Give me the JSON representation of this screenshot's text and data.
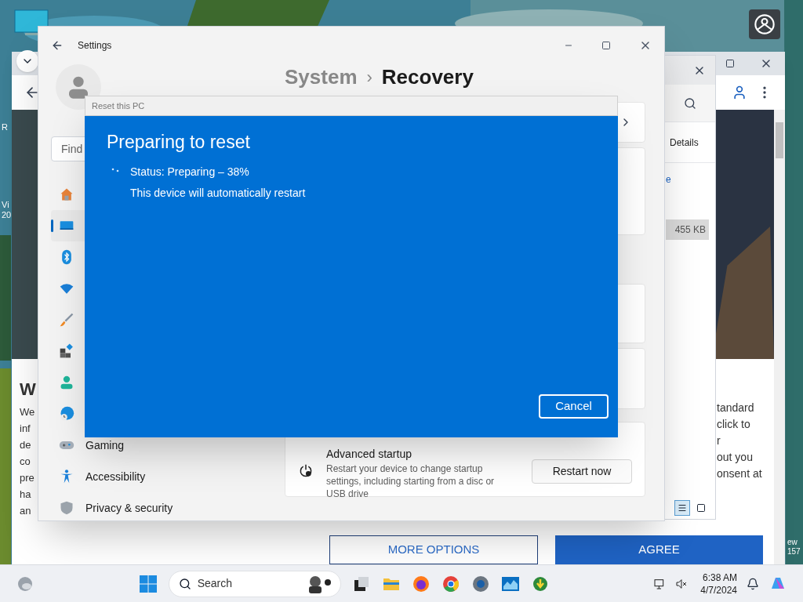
{
  "desktop": {
    "left_labels": [
      "R",
      "Vi",
      "20"
    ],
    "right_labels": [
      "ew",
      "157"
    ]
  },
  "browser": {
    "heading": "W",
    "left_text": [
      "We",
      "inf",
      "de",
      "co",
      "pre",
      "ha",
      "an"
    ],
    "right_text": [
      "tandard",
      "click to",
      "r",
      "out you",
      "onsent at"
    ],
    "buttons": [
      {
        "label": "MORE OPTIONS",
        "kind": "outline"
      },
      {
        "label": "AGREE",
        "kind": "filled"
      }
    ]
  },
  "explorer": {
    "tab": "Details",
    "link": "e",
    "size": "455 KB",
    "views": [
      {
        "selected": true
      },
      {
        "selected": false
      }
    ]
  },
  "settings": {
    "title": "Settings",
    "breadcrumb": [
      "System",
      "›",
      "Recovery"
    ],
    "search": {
      "placeholder": "Find"
    },
    "sidebar": [
      {
        "selected": false
      },
      {
        "selected": true
      },
      {
        "selected": false
      },
      {
        "selected": false
      },
      {
        "selected": false
      },
      {
        "selected": false
      },
      {
        "selected": false
      },
      {
        "selected": false
      },
      {
        "label": "Gaming",
        "selected": false
      },
      {
        "label": "Accessibility",
        "selected": false
      },
      {
        "label": "Privacy & security",
        "selected": false
      }
    ],
    "advanced": {
      "title": "Advanced startup",
      "description": "Restart your device to change startup settings, including starting from a disc or USB drive",
      "button": "Restart now"
    }
  },
  "dialog": {
    "title": "Reset this PC",
    "heading": "Preparing to reset",
    "status": "Status: Preparing – 38%",
    "note": "This device will automatically restart",
    "button": "Cancel"
  },
  "taskbar": {
    "search": "Search",
    "time": "6:38 AM",
    "date": "4/7/2024"
  }
}
